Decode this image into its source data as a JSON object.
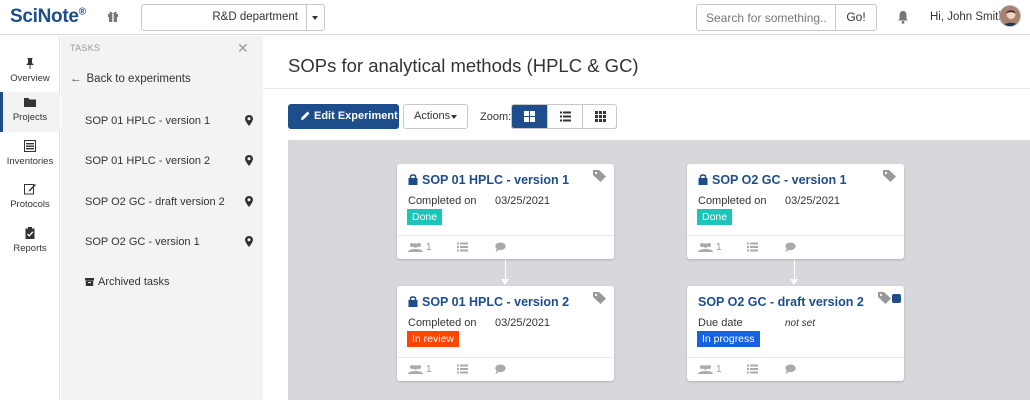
{
  "topbar": {
    "logo": "SciNote",
    "logo_mark": "®",
    "team": "R&D department",
    "search_placeholder": "Search for something...",
    "go_label": "Go!",
    "greeting": "Hi, John Smith"
  },
  "nav": {
    "items": [
      {
        "label": "Overview",
        "icon": "pin-icon"
      },
      {
        "label": "Projects",
        "icon": "folder-icon"
      },
      {
        "label": "Inventories",
        "icon": "list-icon"
      },
      {
        "label": "Protocols",
        "icon": "edit-icon"
      },
      {
        "label": "Reports",
        "icon": "clipboard-icon"
      }
    ],
    "active": "Projects"
  },
  "tasks_panel": {
    "title": "TASKS",
    "back_label": "Back to experiments",
    "items": [
      {
        "label": "SOP 01 HPLC - version 1"
      },
      {
        "label": "SOP 01 HPLC - version 2"
      },
      {
        "label": "SOP O2 GC - draft version 2"
      },
      {
        "label": "SOP O2 GC - version 1"
      }
    ],
    "archived_label": "Archived tasks"
  },
  "main": {
    "title": "SOPs for analytical methods (HPLC & GC)",
    "edit_label": "Edit Experiment",
    "actions_label": "Actions",
    "zoom_label": "Zoom:",
    "zoom_options": [
      "cards-icon",
      "list-detail-icon",
      "grid-icon"
    ]
  },
  "cards": [
    {
      "title": "SOP 01 HPLC - version 1",
      "locked": true,
      "date_label": "Completed on",
      "date_value": "03/25/2021",
      "status": "Done",
      "status_color": "#1dc5b8",
      "users": "1"
    },
    {
      "title": "SOP O2 GC - version 1",
      "locked": true,
      "date_label": "Completed on",
      "date_value": "03/25/2021",
      "status": "Done",
      "status_color": "#1dc5b8",
      "users": "1"
    },
    {
      "title": "SOP 01 HPLC - version 2",
      "locked": true,
      "date_label": "Completed on",
      "date_value": "03/25/2021",
      "status": "In review",
      "status_color": "#ff4500",
      "users": "1"
    },
    {
      "title": "SOP O2 GC - draft version 2",
      "locked": false,
      "date_label": "Due date",
      "date_value": "not set",
      "status": "In progress",
      "status_color": "#1563e0",
      "users": "1"
    }
  ],
  "colors": {
    "brand": "#1e4d8c",
    "canvas": "#d7d8dc",
    "panel": "#f3f3f3"
  }
}
